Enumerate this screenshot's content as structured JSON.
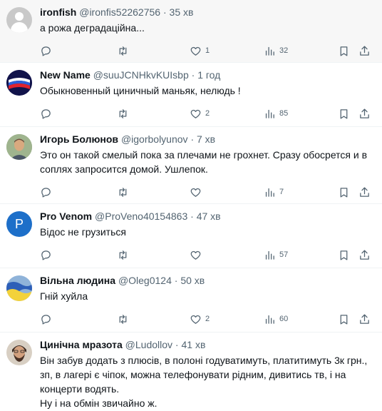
{
  "tweets": [
    {
      "name": "ironfish",
      "handle": "@ironfis52262756",
      "time": "35 хв",
      "text": "а рожа деградаційна...",
      "replies": "",
      "retweets": "",
      "likes": "1",
      "views": "32",
      "avatar_icon": "default-user-avatar"
    },
    {
      "name": "New Name",
      "handle": "@suuJCNHkvKUIsbp",
      "time": "1 год",
      "text": "Обыкновенный циничный маньяк, нелюдь !",
      "replies": "",
      "retweets": "",
      "likes": "2",
      "views": "85",
      "avatar_icon": "tricolor-circle-avatar"
    },
    {
      "name": "Игорь Болюнов",
      "handle": "@igorbolyunov",
      "time": "7 хв",
      "text": "Это он такой смелый пока за плечами не грохнет. Сразу обосрется и в соплях запросится домой. Ушлепок.",
      "replies": "",
      "retweets": "",
      "likes": "",
      "views": "7",
      "avatar_icon": "man-portrait-avatar"
    },
    {
      "name": "Pro Venom",
      "handle": "@ProVeno40154863",
      "time": "47 хв",
      "text": "Відос не грузиться",
      "replies": "",
      "retweets": "",
      "likes": "",
      "views": "57",
      "avatar_icon": "letter-p-avatar",
      "avatar_letter": "P"
    },
    {
      "name": "Вільна людина",
      "handle": "@Oleg0124",
      "time": "50 хв",
      "text": "Гній хуйла",
      "replies": "",
      "retweets": "",
      "likes": "2",
      "views": "60",
      "avatar_icon": "ukraine-flag-avatar"
    },
    {
      "name": "Цинічна мразота",
      "handle": "@Ludollov",
      "time": "41 хв",
      "text": "Він забув додать з плюсів, в полоні годуватимуть, платитимуть 3к грн., зп, в лагері є чіпок, можна телефонувати рідним, дивитись тв, і на концерти водять.\nНу і на обмін звичайно ж.",
      "replies": "",
      "retweets": "",
      "likes": "",
      "views": "",
      "avatar_icon": "bearded-man-avatar"
    }
  ],
  "header_separator": "·",
  "colors": {
    "text": "#0f1419",
    "secondary": "#536471",
    "border": "#eff3f4",
    "hover_bg": "#f7f7f7"
  }
}
